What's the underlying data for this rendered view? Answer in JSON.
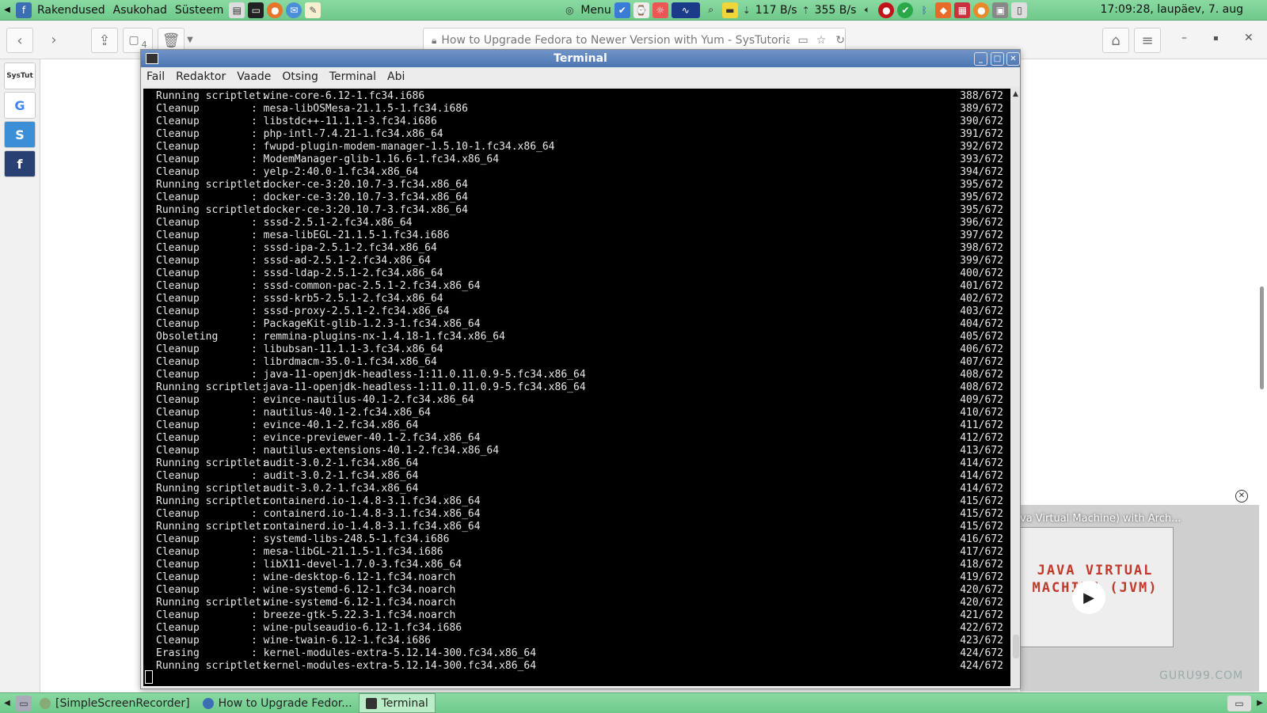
{
  "top_panel": {
    "menus": [
      "Rakendused",
      "Asukohad",
      "Süsteem"
    ],
    "menu_label": "Menu",
    "net_down": "117 B/s",
    "net_up": "355 B/s",
    "clock": "17:09:28, laupäev,  7. aug"
  },
  "browser": {
    "tab_count": "4",
    "page_title": "How to Upgrade Fedora to Newer Version with Yum - SysTutorials",
    "sidebar_items": [
      "SysTut",
      "G",
      "S",
      "f"
    ]
  },
  "terminal": {
    "title": "Terminal",
    "menu": [
      "Fail",
      "Redaktor",
      "Vaade",
      "Otsing",
      "Terminal",
      "Abi"
    ],
    "lines": [
      {
        "action": "Running scriptlet:",
        "pkg": "wine-core-6.12-1.fc34.i686",
        "count": "388/672"
      },
      {
        "action": "Cleanup",
        "pkg": "mesa-libOSMesa-21.1.5-1.fc34.i686",
        "count": "389/672"
      },
      {
        "action": "Cleanup",
        "pkg": "libstdc++-11.1.1-3.fc34.i686",
        "count": "390/672"
      },
      {
        "action": "Cleanup",
        "pkg": "php-intl-7.4.21-1.fc34.x86_64",
        "count": "391/672"
      },
      {
        "action": "Cleanup",
        "pkg": "fwupd-plugin-modem-manager-1.5.10-1.fc34.x86_64",
        "count": "392/672"
      },
      {
        "action": "Cleanup",
        "pkg": "ModemManager-glib-1.16.6-1.fc34.x86_64",
        "count": "393/672"
      },
      {
        "action": "Cleanup",
        "pkg": "yelp-2:40.0-1.fc34.x86_64",
        "count": "394/672"
      },
      {
        "action": "Running scriptlet:",
        "pkg": "docker-ce-3:20.10.7-3.fc34.x86_64",
        "count": "395/672"
      },
      {
        "action": "Cleanup",
        "pkg": "docker-ce-3:20.10.7-3.fc34.x86_64",
        "count": "395/672"
      },
      {
        "action": "Running scriptlet:",
        "pkg": "docker-ce-3:20.10.7-3.fc34.x86_64",
        "count": "395/672"
      },
      {
        "action": "Cleanup",
        "pkg": "sssd-2.5.1-2.fc34.x86_64",
        "count": "396/672"
      },
      {
        "action": "Cleanup",
        "pkg": "mesa-libEGL-21.1.5-1.fc34.i686",
        "count": "397/672"
      },
      {
        "action": "Cleanup",
        "pkg": "sssd-ipa-2.5.1-2.fc34.x86_64",
        "count": "398/672"
      },
      {
        "action": "Cleanup",
        "pkg": "sssd-ad-2.5.1-2.fc34.x86_64",
        "count": "399/672"
      },
      {
        "action": "Cleanup",
        "pkg": "sssd-ldap-2.5.1-2.fc34.x86_64",
        "count": "400/672"
      },
      {
        "action": "Cleanup",
        "pkg": "sssd-common-pac-2.5.1-2.fc34.x86_64",
        "count": "401/672"
      },
      {
        "action": "Cleanup",
        "pkg": "sssd-krb5-2.5.1-2.fc34.x86_64",
        "count": "402/672"
      },
      {
        "action": "Cleanup",
        "pkg": "sssd-proxy-2.5.1-2.fc34.x86_64",
        "count": "403/672"
      },
      {
        "action": "Cleanup",
        "pkg": "PackageKit-glib-1.2.3-1.fc34.x86_64",
        "count": "404/672"
      },
      {
        "action": "Obsoleting",
        "pkg": "remmina-plugins-nx-1.4.18-1.fc34.x86_64",
        "count": "405/672"
      },
      {
        "action": "Cleanup",
        "pkg": "libubsan-11.1.1-3.fc34.x86_64",
        "count": "406/672"
      },
      {
        "action": "Cleanup",
        "pkg": "librdmacm-35.0-1.fc34.x86_64",
        "count": "407/672"
      },
      {
        "action": "Cleanup",
        "pkg": "java-11-openjdk-headless-1:11.0.11.0.9-5.fc34.x86_64",
        "count": "408/672"
      },
      {
        "action": "Running scriptlet:",
        "pkg": "java-11-openjdk-headless-1:11.0.11.0.9-5.fc34.x86_64",
        "count": "408/672"
      },
      {
        "action": "Cleanup",
        "pkg": "evince-nautilus-40.1-2.fc34.x86_64",
        "count": "409/672"
      },
      {
        "action": "Cleanup",
        "pkg": "nautilus-40.1-2.fc34.x86_64",
        "count": "410/672"
      },
      {
        "action": "Cleanup",
        "pkg": "evince-40.1-2.fc34.x86_64",
        "count": "411/672"
      },
      {
        "action": "Cleanup",
        "pkg": "evince-previewer-40.1-2.fc34.x86_64",
        "count": "412/672"
      },
      {
        "action": "Cleanup",
        "pkg": "nautilus-extensions-40.1-2.fc34.x86_64",
        "count": "413/672"
      },
      {
        "action": "Running scriptlet:",
        "pkg": "audit-3.0.2-1.fc34.x86_64",
        "count": "414/672"
      },
      {
        "action": "Cleanup",
        "pkg": "audit-3.0.2-1.fc34.x86_64",
        "count": "414/672"
      },
      {
        "action": "Running scriptlet:",
        "pkg": "audit-3.0.2-1.fc34.x86_64",
        "count": "414/672"
      },
      {
        "action": "Running scriptlet:",
        "pkg": "containerd.io-1.4.8-3.1.fc34.x86_64",
        "count": "415/672"
      },
      {
        "action": "Cleanup",
        "pkg": "containerd.io-1.4.8-3.1.fc34.x86_64",
        "count": "415/672"
      },
      {
        "action": "Running scriptlet:",
        "pkg": "containerd.io-1.4.8-3.1.fc34.x86_64",
        "count": "415/672"
      },
      {
        "action": "Cleanup",
        "pkg": "systemd-libs-248.5-1.fc34.i686",
        "count": "416/672"
      },
      {
        "action": "Cleanup",
        "pkg": "mesa-libGL-21.1.5-1.fc34.i686",
        "count": "417/672"
      },
      {
        "action": "Cleanup",
        "pkg": "libX11-devel-1.7.0-3.fc34.x86_64",
        "count": "418/672"
      },
      {
        "action": "Cleanup",
        "pkg": "wine-desktop-6.12-1.fc34.noarch",
        "count": "419/672"
      },
      {
        "action": "Cleanup",
        "pkg": "wine-systemd-6.12-1.fc34.noarch",
        "count": "420/672"
      },
      {
        "action": "Running scriptlet:",
        "pkg": "wine-systemd-6.12-1.fc34.noarch",
        "count": "420/672"
      },
      {
        "action": "Cleanup",
        "pkg": "breeze-gtk-5.22.3-1.fc34.noarch",
        "count": "421/672"
      },
      {
        "action": "Cleanup",
        "pkg": "wine-pulseaudio-6.12-1.fc34.i686",
        "count": "422/672"
      },
      {
        "action": "Cleanup",
        "pkg": "wine-twain-6.12-1.fc34.i686",
        "count": "423/672"
      },
      {
        "action": "Erasing",
        "pkg": "kernel-modules-extra-5.12.14-300.fc34.x86_64",
        "count": "424/672"
      },
      {
        "action": "Running scriptlet:",
        "pkg": "kernel-modules-extra-5.12.14-300.fc34.x86_64",
        "count": "424/672"
      }
    ]
  },
  "video": {
    "title": "va Virtual Machine) with Arch...",
    "board_text": "JAVA VIRTUAL MACHINE (JVM)",
    "watermark": "GURU99.COM"
  },
  "taskbar": {
    "tasks": [
      "[SimpleScreenRecorder]",
      "How to Upgrade Fedor...",
      "Terminal"
    ]
  },
  "colors": {
    "panel_green": "#7fd196",
    "terminal_bg": "#000000",
    "terminal_title": "#5a80b8"
  }
}
